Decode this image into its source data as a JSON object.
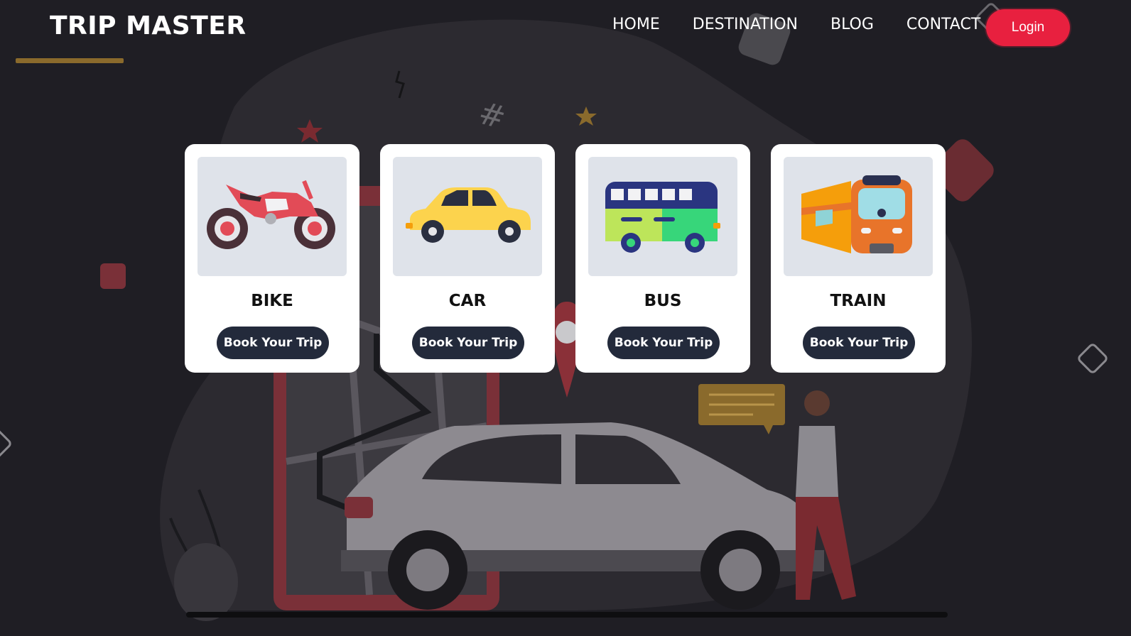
{
  "brand": "TRIP MASTER",
  "nav": {
    "home": "HOME",
    "destination": "DESTINATION",
    "blog": "BLOG",
    "contact": "CONTACT",
    "login": "Login"
  },
  "cards": [
    {
      "title": "BIKE",
      "button": "Book Your Trip",
      "icon": "motorbike-icon"
    },
    {
      "title": "CAR",
      "button": "Book Your Trip",
      "icon": "car-icon"
    },
    {
      "title": "BUS",
      "button": "Book Your Trip",
      "icon": "bus-icon"
    },
    {
      "title": "TRAIN",
      "button": "Book Your Trip",
      "icon": "train-icon"
    }
  ],
  "colors": {
    "background": "#1f1e24",
    "accent": "#e8203f",
    "button": "#232a3b",
    "underline": "#8a6a2c"
  }
}
